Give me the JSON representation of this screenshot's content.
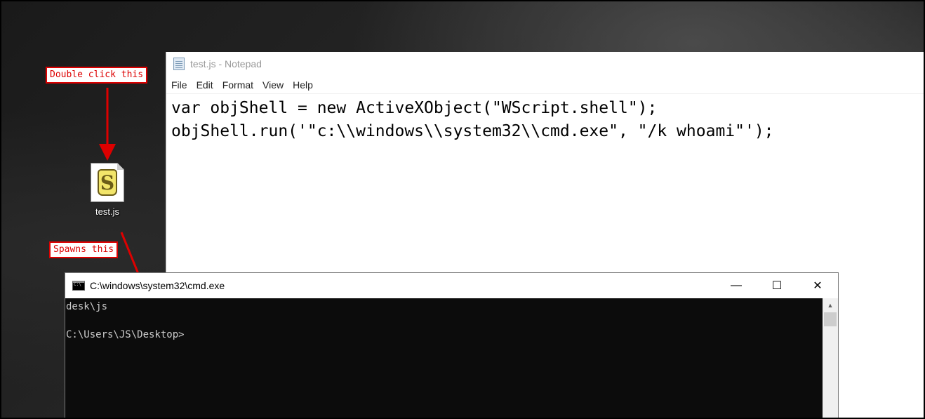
{
  "notepad": {
    "title": "test.js - Notepad",
    "menu": [
      "File",
      "Edit",
      "Format",
      "View",
      "Help"
    ],
    "content": "var objShell = new ActiveXObject(\"WScript.shell\");\nobjShell.run('\"c:\\\\windows\\\\system32\\\\cmd.exe\", \"/k whoami\"');"
  },
  "desktop_icon": {
    "label": "test.js",
    "icon": "javascript-script-file-icon"
  },
  "annotations": {
    "double_click": "Double click this",
    "spawns": "Spawns this",
    "color": "#dd0000"
  },
  "cmd": {
    "title": "C:\\windows\\system32\\cmd.exe",
    "minimize": "—",
    "maximize": "☐",
    "close": "✕",
    "output": "desk\\js\n\nC:\\Users\\JS\\Desktop>"
  }
}
